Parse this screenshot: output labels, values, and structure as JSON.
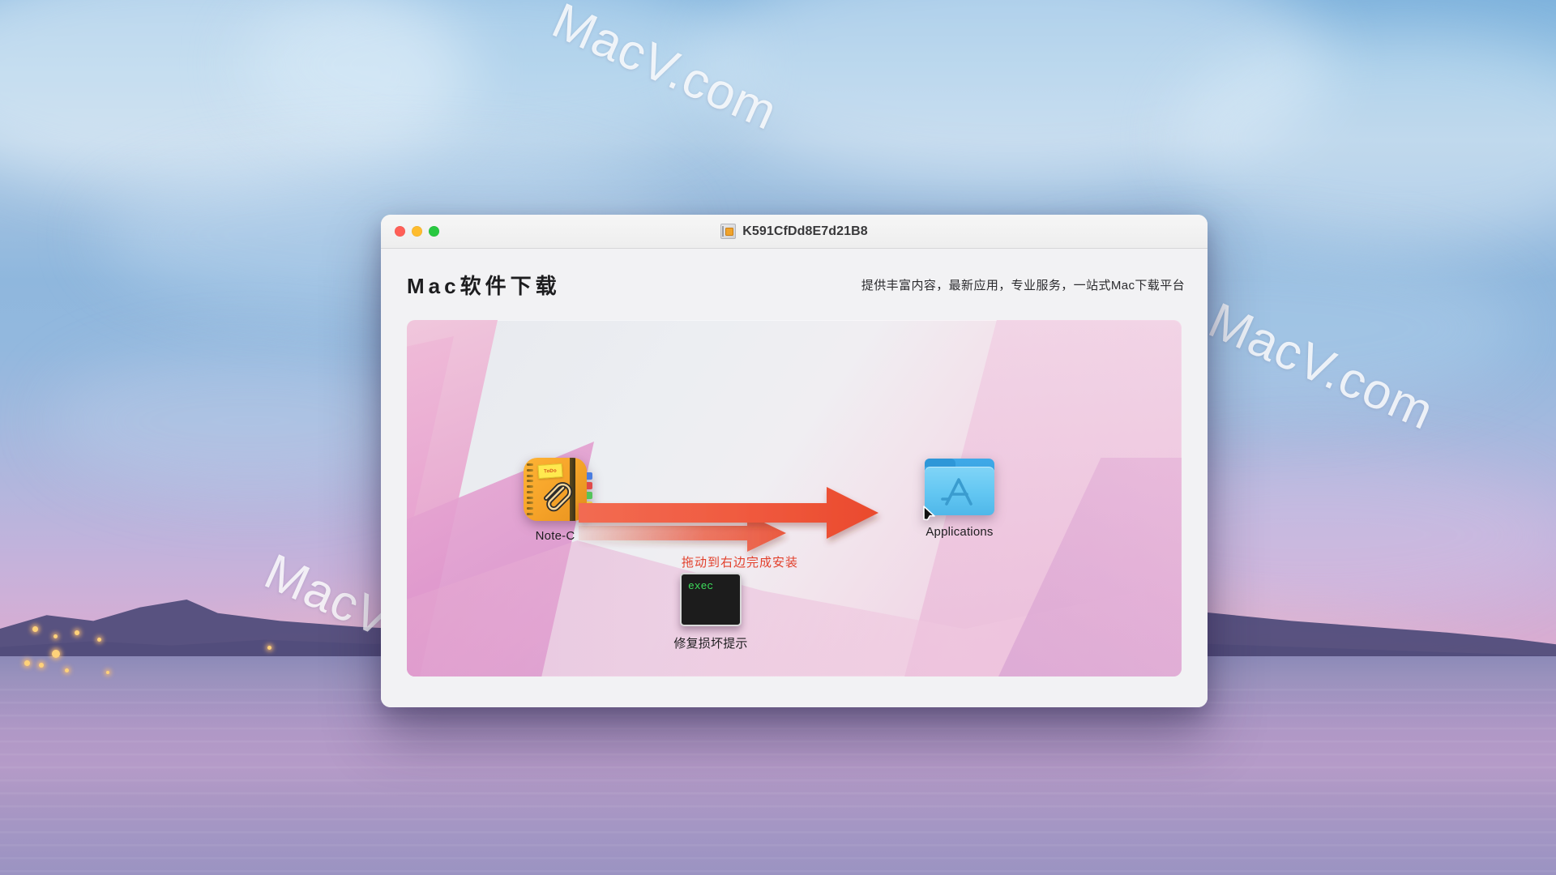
{
  "window": {
    "title": "K591CfDd8E7d21B8",
    "title_icon": "disk-image-icon",
    "traffic_lights": {
      "close": "close-button",
      "minimize": "minimize-button",
      "zoom": "zoom-button"
    }
  },
  "header": {
    "brand_title": "Mac软件下载",
    "brand_subtitle": "提供丰富内容，最新应用，专业服务，一站式Mac下载平台"
  },
  "install_panel": {
    "app": {
      "name": "Note-C",
      "icon": "notebook-app-icon",
      "sticky_note_text": "ToDo"
    },
    "destination": {
      "name": "Applications",
      "icon": "applications-folder-icon"
    },
    "arrow": {
      "icon": "drag-arrow-icon",
      "instruction": "拖动到右边完成安装"
    },
    "repair_tool": {
      "name": "修复损坏提示",
      "icon": "terminal-exec-icon",
      "terminal_text": "exec"
    }
  },
  "wallpaper": {
    "watermarks": [
      "MacV.com",
      "MacV.com",
      "MacV.com"
    ]
  },
  "colors": {
    "accent_red": "#e2402c",
    "folder_blue": "#62c6f2",
    "app_orange": "#f5a228",
    "terminal_green": "#3ddc5b",
    "title_text": "#38383a"
  }
}
